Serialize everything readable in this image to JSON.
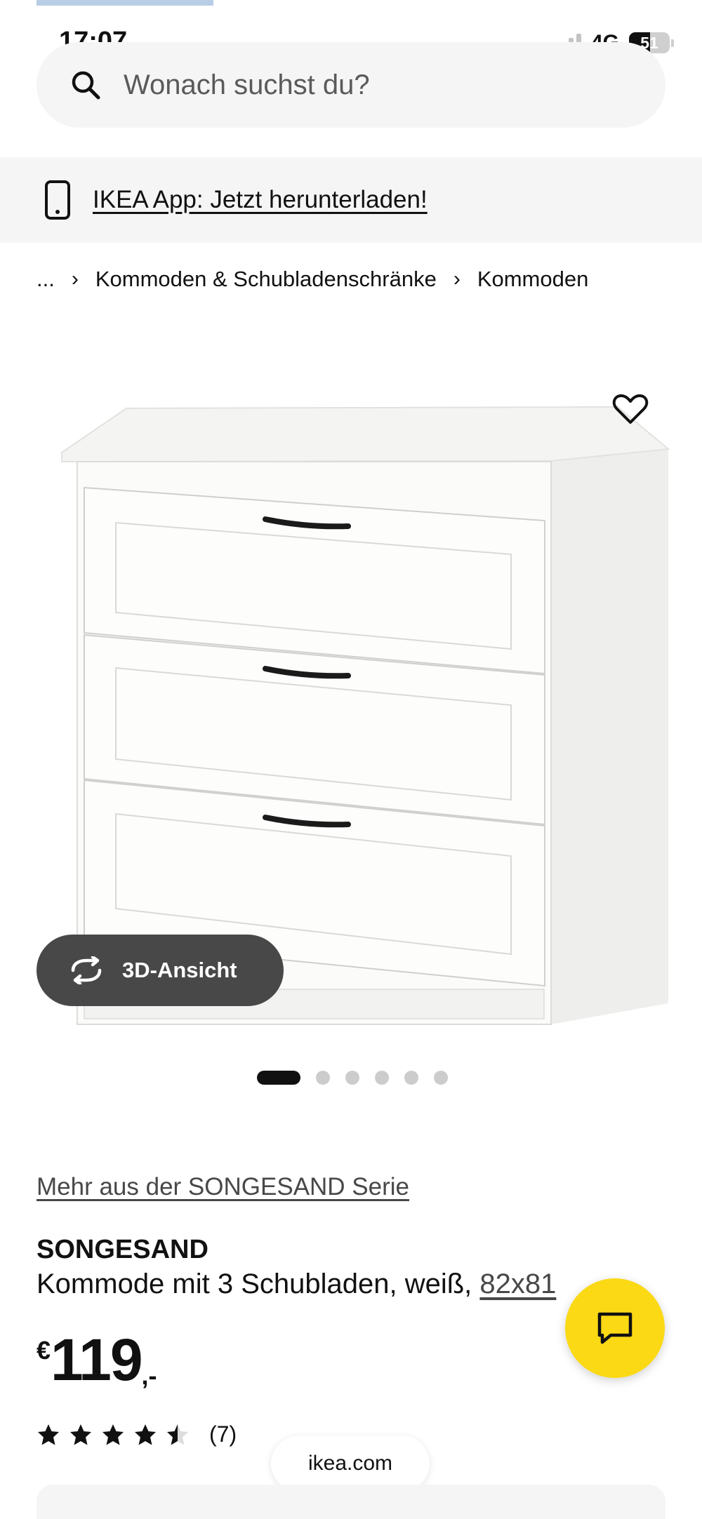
{
  "status_bar": {
    "time": "17:07",
    "network": "4G",
    "battery": "51",
    "battery_level_fraction": 0.51,
    "signal_bars_active": 2,
    "signal_bars_total": 4
  },
  "search": {
    "placeholder": "Wonach suchst du?",
    "icon": "search-icon"
  },
  "app_banner": {
    "icon": "phone-icon",
    "text": "IKEA App: Jetzt herunterladen!"
  },
  "breadcrumb": {
    "items": [
      "...",
      "Kommoden & Schubladenschränke",
      "Kommoden"
    ],
    "separator_icon": "chevron-right-icon"
  },
  "product_image": {
    "favorite_icon": "heart-icon",
    "view_3d_label": "3D-Ansicht",
    "view_3d_icon": "rotate-icon"
  },
  "carousel": {
    "total_images": 6,
    "active_index": 0
  },
  "product": {
    "series_link": "Mehr aus der SONGESAND Serie",
    "name": "SONGESAND",
    "description": "Kommode mit 3 Schubladen, weiß, ",
    "dimensions": "82x81",
    "price_currency": "€",
    "price_integer": "119",
    "price_decimal": ",-",
    "rating_value": 4.5,
    "rating_max": 5,
    "review_count": "(7)"
  },
  "browser": {
    "url": "ikea.com"
  },
  "chat": {
    "icon": "chat-icon"
  },
  "colors": {
    "accent_yellow": "#fbd914",
    "background_light": "#f5f5f5",
    "text_primary": "#111111",
    "button_dark": "#484848"
  }
}
